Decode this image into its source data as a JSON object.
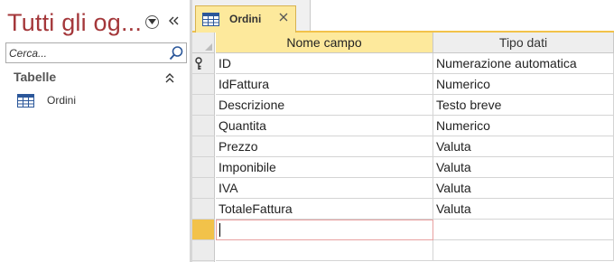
{
  "nav": {
    "title": "Tutti gli og...",
    "menu_icon": "dropdown-circle-icon",
    "collapse_icon": "double-chevron-left-icon",
    "search_placeholder": "Cerca...",
    "search_icon": "magnifier-icon",
    "group_label": "Tabelle",
    "group_toggle_icon": "double-chevron-up-icon",
    "items": [
      {
        "label": "Ordini",
        "icon": "table-icon"
      }
    ]
  },
  "tab": {
    "label": "Ordini",
    "icon": "table-icon",
    "close_icon": "close-icon"
  },
  "grid": {
    "columns": [
      "Nome campo",
      "Tipo dati"
    ],
    "primary_key_icon": "key-icon",
    "rows": [
      {
        "name": "ID",
        "type": "Numerazione automatica",
        "primary_key": true
      },
      {
        "name": "IdFattura",
        "type": "Numerico"
      },
      {
        "name": "Descrizione",
        "type": "Testo breve"
      },
      {
        "name": "Quantita",
        "type": "Numerico"
      },
      {
        "name": "Prezzo",
        "type": "Valuta"
      },
      {
        "name": "Imponibile",
        "type": "Valuta"
      },
      {
        "name": "IVA",
        "type": "Valuta"
      },
      {
        "name": "TotaleFattura",
        "type": "Valuta"
      }
    ],
    "new_row": {
      "name": "",
      "type": ""
    }
  },
  "colors": {
    "title": "#a4373a",
    "tab_active": "#fde99c",
    "selected_header": "#fde99c",
    "current_row_selector": "#f2c24a"
  }
}
